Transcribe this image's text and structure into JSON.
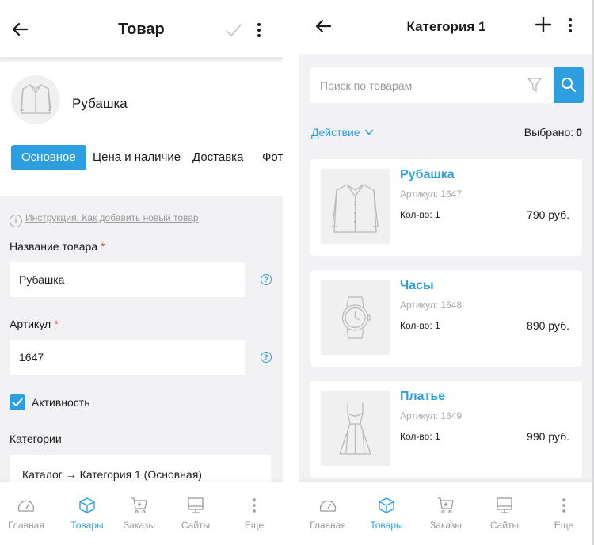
{
  "left": {
    "header": {
      "title": "Товар",
      "back_icon": "arrow-left-icon",
      "confirm_icon": "check-icon",
      "menu_icon": "more-vertical-icon"
    },
    "product": {
      "name": "Рубашка",
      "thumb_icon": "shirt-icon"
    },
    "tabs": [
      {
        "label": "Основное",
        "active": true
      },
      {
        "label": "Цена и наличие",
        "active": false
      },
      {
        "label": "Доставка",
        "active": false
      },
      {
        "label": "Фото",
        "active": false
      }
    ],
    "hint": "Инструкция. Как добавить новый товар",
    "fields": {
      "name_label": "Название товара",
      "name_value": "Рубашка",
      "sku_label": "Артикул",
      "sku_value": "1647",
      "required_mark": "*",
      "help_mark": "?"
    },
    "active_checkbox": {
      "label": "Активность",
      "checked": true
    },
    "categories": {
      "label": "Категории",
      "value": "Каталог → Категория 1 (Основная)"
    }
  },
  "right": {
    "header": {
      "title": "Категория 1",
      "back_icon": "arrow-left-icon",
      "add_icon": "plus-icon",
      "menu_icon": "more-vertical-icon"
    },
    "search": {
      "placeholder": "Поиск по товарам"
    },
    "action_label": "Действие",
    "selected_label": "Выбрано:",
    "selected_count": "0",
    "products": [
      {
        "name": "Рубашка",
        "sku": "Артикул: 1647",
        "qty": "Кол-во: 1",
        "price": "790 руб.",
        "icon": "shirt-icon"
      },
      {
        "name": "Часы",
        "sku": "Артикул: 1648",
        "qty": "Кол-во: 1",
        "price": "890 руб.",
        "icon": "watch-icon"
      },
      {
        "name": "Платье",
        "sku": "Артикул: 1649",
        "qty": "Кол-во: 1",
        "price": "990 руб.",
        "icon": "dress-icon"
      }
    ]
  },
  "nav": [
    {
      "label": "Главная",
      "icon": "dashboard-icon",
      "active": false
    },
    {
      "label": "Товары",
      "icon": "box-icon",
      "active": true
    },
    {
      "label": "Заказы",
      "icon": "cart-icon",
      "active": false
    },
    {
      "label": "Сайты",
      "icon": "monitor-icon",
      "active": false
    },
    {
      "label": "Еще",
      "icon": "more-vertical-icon",
      "active": false
    }
  ],
  "colors": {
    "accent": "#2d9ee0",
    "required": "#e0443e",
    "background": "#f2f2f4"
  }
}
